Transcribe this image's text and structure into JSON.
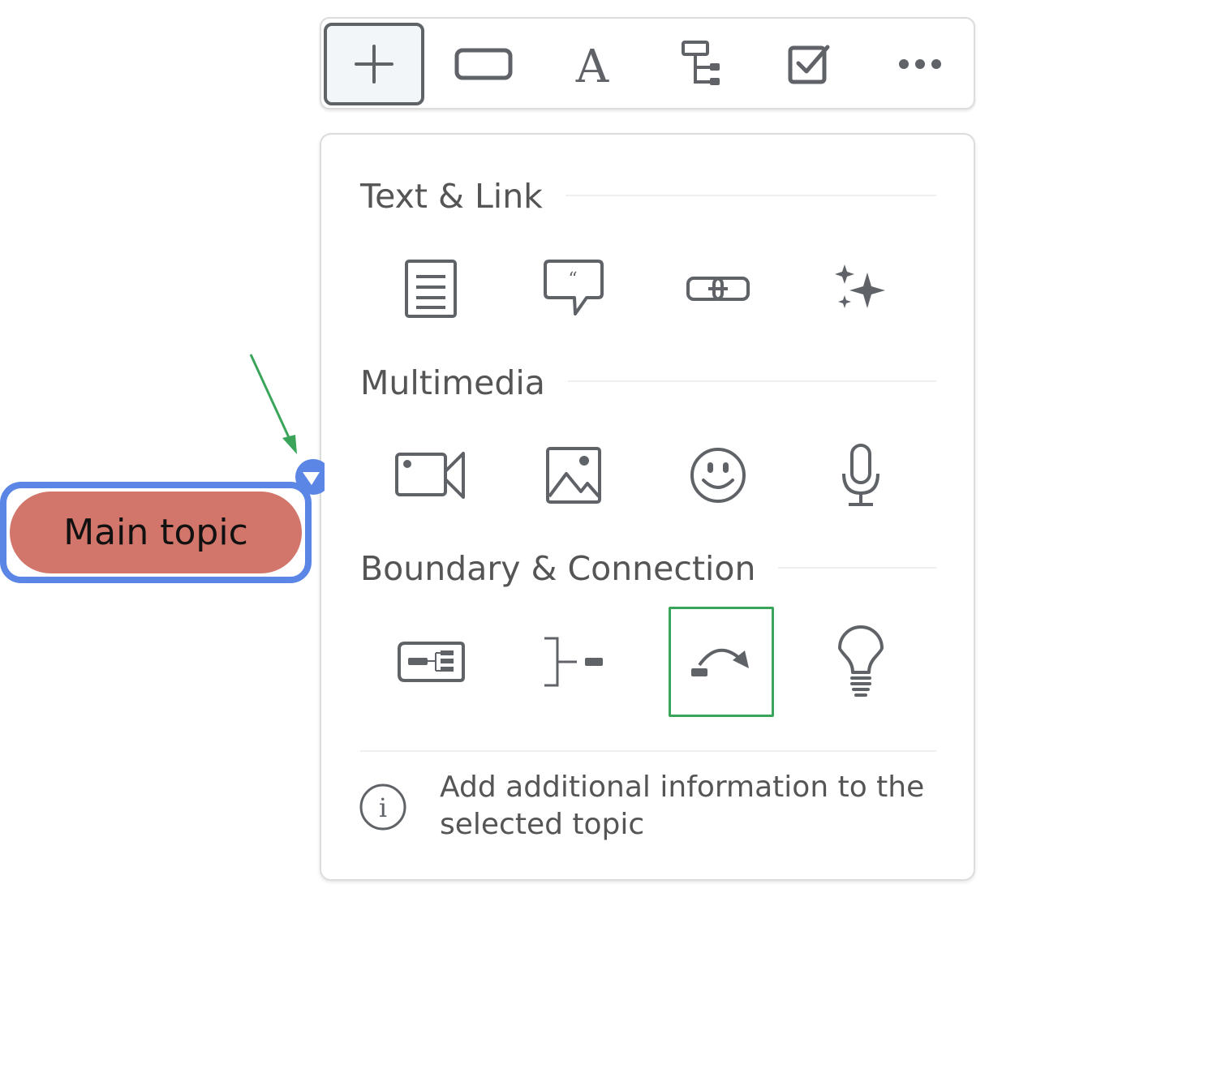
{
  "toolbar": {
    "buttons": [
      {
        "name": "add-button",
        "icon": "plus-icon",
        "active": true
      },
      {
        "name": "topic-shape-button",
        "icon": "rounded-rectangle-icon"
      },
      {
        "name": "text-button",
        "icon": "letter-a-icon",
        "glyph": "A"
      },
      {
        "name": "subtopic-button",
        "icon": "tree-structure-icon"
      },
      {
        "name": "task-button",
        "icon": "checkbox-icon"
      },
      {
        "name": "more-button",
        "icon": "more-horizontal-icon"
      }
    ]
  },
  "panel": {
    "sections": [
      {
        "title": "Text & Link",
        "items": [
          {
            "name": "note",
            "icon": "note-icon"
          },
          {
            "name": "comment",
            "icon": "comment-icon",
            "glyph": "“"
          },
          {
            "name": "link",
            "icon": "link-icon"
          },
          {
            "name": "ai",
            "icon": "sparkles-icon"
          }
        ]
      },
      {
        "title": "Multimedia",
        "items": [
          {
            "name": "video",
            "icon": "video-camera-icon"
          },
          {
            "name": "image",
            "icon": "image-icon"
          },
          {
            "name": "sticker",
            "icon": "smiley-icon"
          },
          {
            "name": "audio",
            "icon": "microphone-icon"
          }
        ]
      },
      {
        "title": "Boundary & Connection",
        "items": [
          {
            "name": "boundary",
            "icon": "boundary-icon"
          },
          {
            "name": "summary",
            "icon": "summary-bracket-icon"
          },
          {
            "name": "relationship",
            "icon": "curved-arrow-icon",
            "selected": true
          },
          {
            "name": "insight",
            "icon": "lightbulb-icon"
          }
        ]
      }
    ],
    "info": {
      "icon": "info-icon",
      "glyph": "i",
      "text": "Add additional information to the selected topic"
    }
  },
  "canvas": {
    "topic": {
      "label": "Main topic",
      "selected": true
    },
    "colors": {
      "topic_fill": "#d2766b",
      "selection": "#5b86e5",
      "highlight": "#3aa55a",
      "icon": "#5f6368"
    }
  }
}
